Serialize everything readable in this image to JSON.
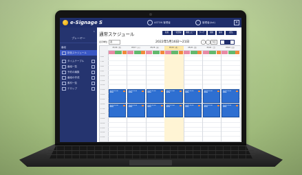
{
  "app": {
    "logo_text": "e-Signage S",
    "header_user": "ASTON 管理者",
    "header_account": "管理者(Ast)",
    "close_glyph": "×",
    "brand_color": "#1f2e6b"
  },
  "sidebar": {
    "collapse_glyph": "«",
    "player_label": "プレーヤー",
    "section_label": "番組",
    "items": [
      {
        "label": "配信スケジュール",
        "active": true
      },
      {
        "label": "タイムテーブル",
        "active": false
      },
      {
        "label": "番組一覧",
        "active": false
      },
      {
        "label": "予約の編集",
        "active": false
      },
      {
        "label": "番組の作成",
        "active": false
      },
      {
        "label": "素材一覧",
        "active": false
      },
      {
        "label": "テロップ",
        "active": false
      }
    ]
  },
  "main": {
    "title": "通常スケジュール",
    "toolbar": [
      "新規",
      "一括登録",
      "期間コピー",
      "クリア",
      "削除",
      "保存",
      "配信"
    ],
    "display_label": "表示単位",
    "display_value": "週",
    "date_range": "2022年5月16日～21日",
    "prev_glyph": "‹",
    "next_glyph": "›",
    "today_label": "今日",
    "days": [
      {
        "head": "05/16（月）",
        "today": false
      },
      {
        "head": "05/17（火）",
        "today": false
      },
      {
        "head": "05/18（水）",
        "today": false
      },
      {
        "head": "05/19（木）",
        "today": true
      },
      {
        "head": "05/20（金）",
        "today": false
      },
      {
        "head": "05/21（土）",
        "today": false
      },
      {
        "head": "05/22（日）",
        "today": false
      }
    ],
    "times": [
      "6:00",
      "7:00",
      "8:00",
      "9:00",
      "10:00",
      "11:00",
      "12:00",
      "13:00",
      "14:00",
      "15:00",
      "16:00",
      "17:00",
      "18:00",
      "19:00",
      "20:00",
      "21:00",
      "22:00",
      "23:00"
    ],
    "event_text": [
      "10:00-12:00",
      "番組A"
    ],
    "colors": {
      "event": "#2e6fd1",
      "tag_pink": "#e98aa5",
      "tag_green": "#63b86d",
      "tag_orange": "#f18a3b",
      "today": "#fff4d4"
    }
  }
}
